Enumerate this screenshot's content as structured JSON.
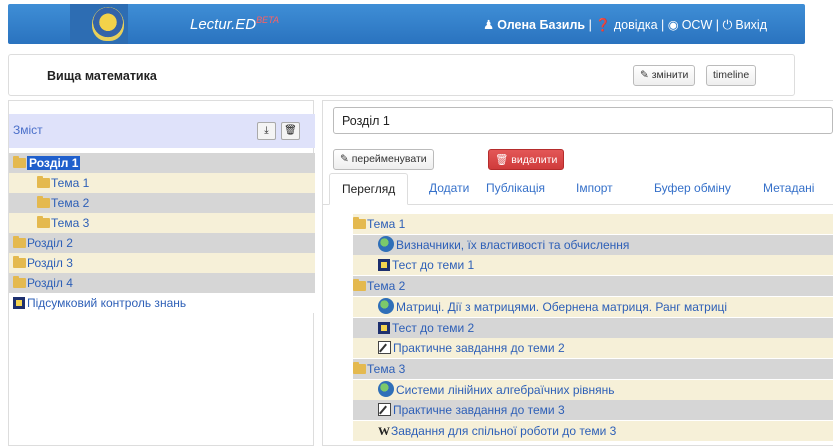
{
  "header": {
    "brand": "Lectur.ED",
    "brand_sup": "BETA",
    "user_name": "Олена Базиль",
    "help_label": "довідка",
    "ocw_label": "OCW",
    "exit_label": "Вихід",
    "sep": "|"
  },
  "course": {
    "title": "Вища математика",
    "edit_label": "змінити",
    "timeline_label": "timeline"
  },
  "toc": {
    "title": "Зміст",
    "items": [
      {
        "label": "Розділ 1",
        "type": "folder",
        "level": 0,
        "selected": true
      },
      {
        "label": "Тема 1",
        "type": "folder",
        "level": 1
      },
      {
        "label": "Тема 2",
        "type": "folder",
        "level": 1
      },
      {
        "label": "Тема 3",
        "type": "folder",
        "level": 1
      },
      {
        "label": "Розділ 2",
        "type": "folder",
        "level": 0
      },
      {
        "label": "Розділ 3",
        "type": "folder",
        "level": 0
      },
      {
        "label": "Розділ 4",
        "type": "folder",
        "level": 0
      },
      {
        "label": "Підсумковий контроль знань",
        "type": "test",
        "level": 0
      }
    ]
  },
  "section": {
    "name": "Розділ 1",
    "rename_label": "перейменувати",
    "delete_label": "видалити"
  },
  "tabs": [
    "Перегляд",
    "Додати",
    "Публікація",
    "Імпорт",
    "Буфер обміну",
    "Метадані"
  ],
  "content": [
    {
      "label": "Тема 1",
      "type": "folder",
      "level": 0
    },
    {
      "label": "Визначники, їх властивості та обчислення",
      "type": "lecture",
      "level": 1
    },
    {
      "label": "Тест до теми 1",
      "type": "test",
      "level": 1
    },
    {
      "label": "Тема 2",
      "type": "folder",
      "level": 0
    },
    {
      "label": "Матриці. Дії з матрицями. Обернена матриця. Ранг матриці",
      "type": "lecture",
      "level": 1
    },
    {
      "label": "Тест до теми 2",
      "type": "test",
      "level": 1
    },
    {
      "label": "Практичне завдання до теми 2",
      "type": "task",
      "level": 1
    },
    {
      "label": "Тема 3",
      "type": "folder",
      "level": 0
    },
    {
      "label": "Системи лінійних алгебраїчних рівнянь",
      "type": "lecture",
      "level": 1
    },
    {
      "label": "Практичне завдання до теми 3",
      "type": "task",
      "level": 1
    },
    {
      "label": "Завдання для спільної роботи до теми 3",
      "type": "wiki",
      "level": 1
    }
  ],
  "colors": {
    "header_blue": "#2f7fcf",
    "selected_blue": "#1f5fcc",
    "row_grey": "#d6d6d6",
    "row_cream": "#f6f0d8",
    "delete_red": "#d94343"
  },
  "icons": {
    "folder": "folder-icon",
    "test": "test-icon",
    "lecture": "lecture-globe-icon",
    "task": "task-icon",
    "wiki": "wiki-icon"
  }
}
